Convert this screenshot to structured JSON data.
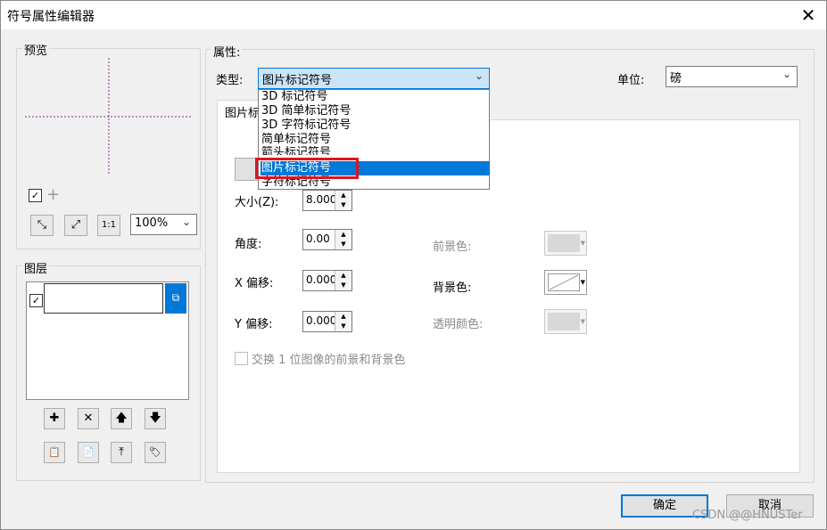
{
  "window": {
    "title": "符号属性编辑器",
    "close": "✕"
  },
  "preview": {
    "label": "预览",
    "zoom_value": "100%",
    "buttons": [
      "⤡",
      "⤢",
      "1:1"
    ]
  },
  "layers": {
    "label": "图层",
    "tool_row1": [
      "✚",
      "✕",
      "🡅",
      "🡇"
    ],
    "tool_row2": [
      "📋",
      "📄",
      "⤒",
      "🏷"
    ]
  },
  "properties": {
    "label": "属性:",
    "type_label": "类型:",
    "type_value": "图片标记符号",
    "unit_label": "单位:",
    "unit_value": "磅",
    "type_options": [
      "3D 标记符号",
      "3D 简单标记符号",
      "3D 字符标记符号",
      "简单标记符号",
      "箭头标记符号",
      "图片标记符号",
      "字符标记符号"
    ],
    "highlighted_option": "图片标记符号",
    "tab_label": "图片标"
  },
  "fields": {
    "size_label": "大小(Z):",
    "size_value": "8.000",
    "angle_label": "角度:",
    "angle_value": "0.00",
    "xoffset_label": "X 偏移:",
    "xoffset_value": "0.000",
    "yoffset_label": "Y 偏移:",
    "yoffset_value": "0.000",
    "fg_label": "前景色:",
    "bg_label": "背景色:",
    "transparent_label": "透明颜色:",
    "swap_label": "交换 1 位图像的前景和背景色"
  },
  "footer": {
    "ok": "确定",
    "cancel": "取消"
  },
  "watermark": "CSDN @@HNUSTer",
  "colors": {
    "accent": "#0078d7",
    "highlight_box": "#e0141e"
  }
}
